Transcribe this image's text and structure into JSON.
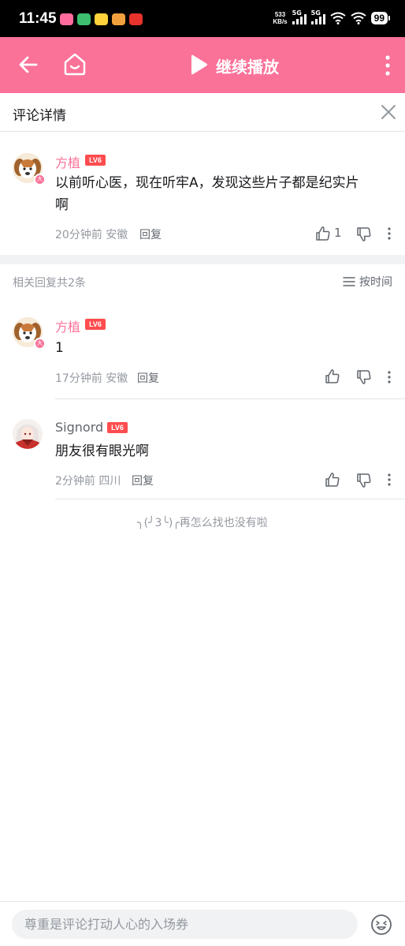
{
  "status_bar": {
    "time": "11:45",
    "net_speed_value": "533",
    "net_speed_unit": "KB/s",
    "signal_1_label": "5G",
    "signal_2_label": "5G",
    "battery": "99"
  },
  "top_bar": {
    "title": "继续播放",
    "accent_color": "#fb7299"
  },
  "comment_header": {
    "title": "评论详情"
  },
  "main_comment": {
    "username": "方植",
    "level": "LV6",
    "text_line1": "以前听心医，现在听牢A，发现这些片子都是纪实片",
    "text_line2": "啊",
    "time": "20分钟前",
    "location": "安徽",
    "reply_label": "回复",
    "like_count": "1"
  },
  "replies_header": {
    "count_text": "相关回复共2条",
    "sort_label": "按时间"
  },
  "replies": [
    {
      "username": "方植",
      "level": "LV6",
      "text": "1",
      "time": "17分钟前",
      "location": "安徽",
      "reply_label": "回复"
    },
    {
      "username": "Signord",
      "level": "LV6",
      "text": "朋友很有眼光啊",
      "time": "2分钟前",
      "location": "四川",
      "reply_label": "回复"
    }
  ],
  "end_note": "╮(╯3╰)╭再怎么找也没有啦",
  "bottom": {
    "placeholder": "尊重是评论打动人心的入场券"
  }
}
